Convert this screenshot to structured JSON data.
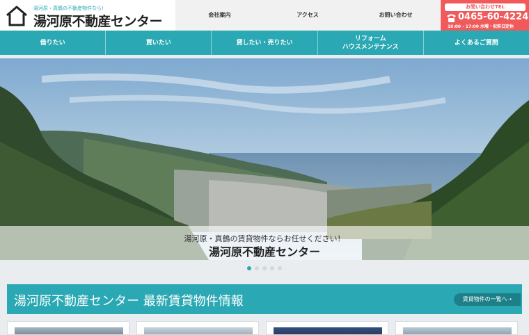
{
  "header": {
    "logo_tagline": "湯河原・真鶴の不動産物件なら!",
    "logo_name": "湯河原不動産センター",
    "topnav": [
      "会社案内",
      "アクセス",
      "お問い合わせ"
    ],
    "tel_label": "お問い合わせTEL",
    "tel_number": "0465-60-4224",
    "tel_hours": "10:00 - 17:00 水曜・祝祭日定休"
  },
  "mainnav": [
    {
      "label": "借りたい"
    },
    {
      "label": "買いたい"
    },
    {
      "label": "貸したい・売りたい"
    },
    {
      "label": "リフォーム\nハウスメンテナンス"
    },
    {
      "label": "よくあるご質問"
    }
  ],
  "hero": {
    "subtitle": "湯河原・真鶴の賃貸物件ならお任せください！",
    "title": "湯河原不動産センター"
  },
  "slider": {
    "count": 5,
    "active": 1
  },
  "section": {
    "title": "湯河原不動産センター 最新賃貸物件情報",
    "link_label": "賃貸物件の一覧へ➝"
  },
  "colors": {
    "accent": "#2aa8b3",
    "tel_bg": "#f05a5a",
    "link_bg": "#1d7f88"
  },
  "icons": {
    "logo": "house-icon",
    "tel": "phone-icon"
  }
}
